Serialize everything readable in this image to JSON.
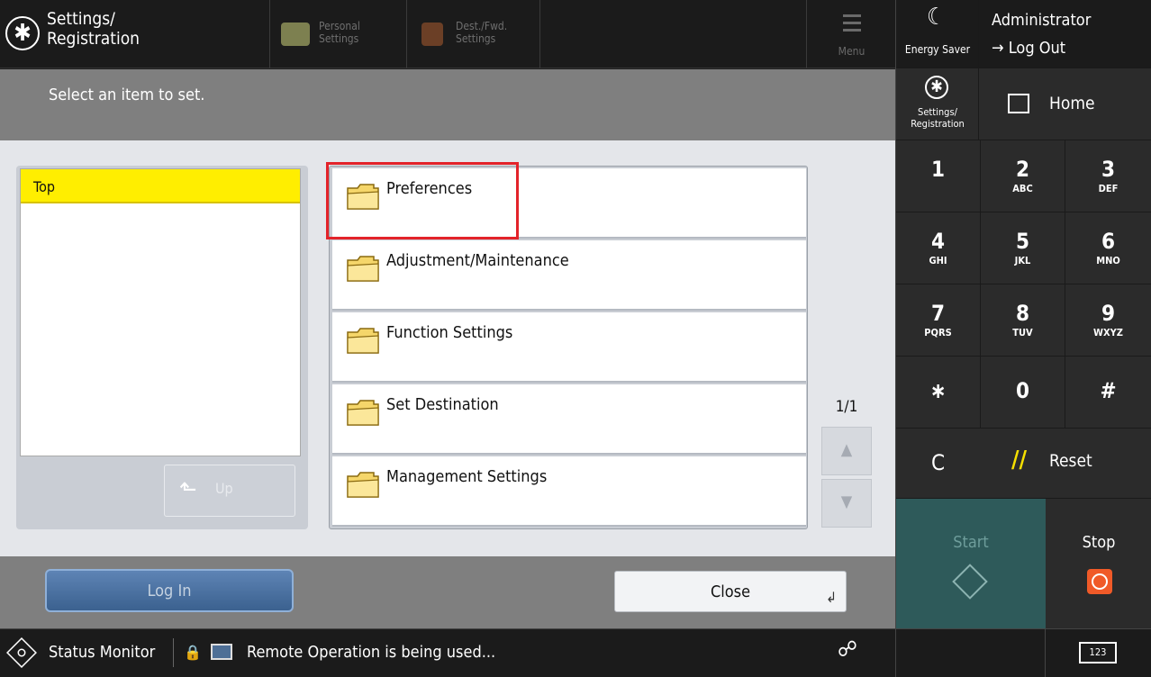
{
  "header": {
    "title": "Settings/\nRegistration",
    "personal_settings": "Personal\nSettings",
    "dest_fwd_settings": "Dest./Fwd.\nSettings",
    "menu": "Menu"
  },
  "message": "Select an item to set.",
  "tree": {
    "top_label": "Top",
    "up_label": "Up",
    "up_arrow": "⬑"
  },
  "items": [
    {
      "label": "Preferences"
    },
    {
      "label": "Adjustment/Maintenance"
    },
    {
      "label": "Function Settings"
    },
    {
      "label": "Set Destination"
    },
    {
      "label": "Management Settings"
    }
  ],
  "pagination": {
    "indicator": "1/1",
    "up": "▲",
    "down": "▼"
  },
  "bottom": {
    "login": "Log In",
    "close": "Close",
    "close_return": "↲"
  },
  "status": {
    "monitor": "Status Monitor",
    "remote": "Remote Operation is being used...",
    "lock": "🔒",
    "remote_icon": "☍",
    "keyboard": "123"
  },
  "right_panel": {
    "energy_saver": "Energy Saver",
    "energy_icon": "☾",
    "admin": "Administrator",
    "logout": "→ Log Out",
    "settings_registration": "Settings/\nRegistration",
    "home": "Home",
    "keys": [
      {
        "digit": "1",
        "letters": ""
      },
      {
        "digit": "2",
        "letters": "ABC"
      },
      {
        "digit": "3",
        "letters": "DEF"
      },
      {
        "digit": "4",
        "letters": "GHI"
      },
      {
        "digit": "5",
        "letters": "JKL"
      },
      {
        "digit": "6",
        "letters": "MNO"
      },
      {
        "digit": "7",
        "letters": "PQRS"
      },
      {
        "digit": "8",
        "letters": "TUV"
      },
      {
        "digit": "9",
        "letters": "WXYZ"
      }
    ],
    "star": "∗",
    "zero": "0",
    "hash": "#",
    "clear": "C",
    "reset": "Reset",
    "reset_icon": "//",
    "start": "Start",
    "stop": "Stop"
  },
  "colors": {
    "highlight": "#ffee00",
    "selection_box": "#e3232a",
    "start_bg": "#2e5a5a",
    "stop_icon": "#f05a28"
  }
}
